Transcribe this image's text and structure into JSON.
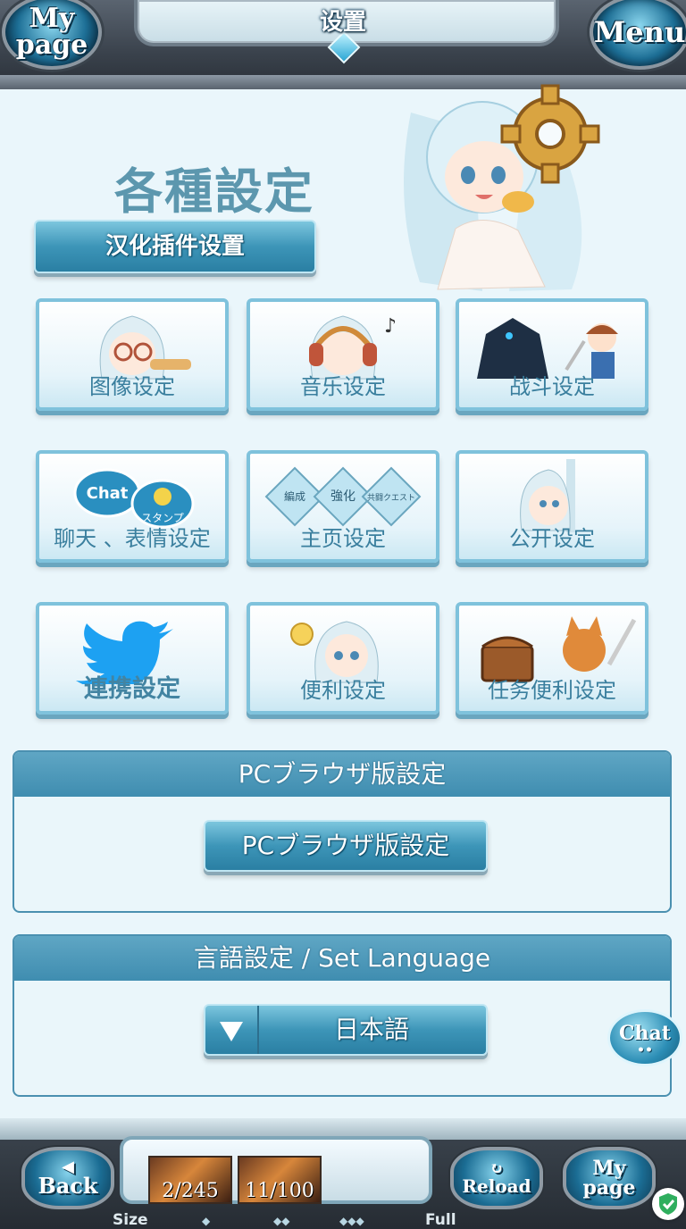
{
  "header": {
    "title": "设置",
    "left_button": "My page",
    "right_button": "Menu"
  },
  "hero": {
    "title": "各種設定",
    "plugin_button": "汉化插件设置"
  },
  "tiles": [
    {
      "label": "图像设定",
      "icon": "glasses-girl-icon"
    },
    {
      "label": "音乐设定",
      "icon": "headphones-girl-icon"
    },
    {
      "label": "战斗设定",
      "icon": "battle-characters-icon"
    },
    {
      "label": "聊天 、表情设定",
      "icon": "chat-stamp-icon",
      "icon_text_1": "Chat",
      "icon_text_2": "スタンプ"
    },
    {
      "label": "主页设定",
      "icon": "diamond-cards-icon",
      "icon_text_1": "編成",
      "icon_text_2": "強化",
      "icon_text_3": "共闘クエスト"
    },
    {
      "label": "公开设定",
      "icon": "peeking-girl-icon"
    },
    {
      "label": "連携設定",
      "icon": "twitter-bird-icon"
    },
    {
      "label": "便利设定",
      "icon": "lightbulb-girl-icon"
    },
    {
      "label": "任务便利设定",
      "icon": "treasure-cat-icon"
    }
  ],
  "pc_panel": {
    "header": "PCブラウザ版設定",
    "button": "PCブラウザ版設定"
  },
  "lang_panel": {
    "header": "言語設定 / Set Language",
    "selected": "日本語"
  },
  "chat_button": "Chat",
  "footer": {
    "back": "Back",
    "reload": "Reload",
    "mypage": "My page",
    "counter_1": "2/245",
    "counter_2": "11/100",
    "size_label": "Size",
    "full_label": "Full"
  },
  "colors": {
    "accent": "#3f8db0",
    "tile_border": "#7fc2dc",
    "label_text": "#3a7f9e",
    "twitter": "#1da1f2"
  }
}
